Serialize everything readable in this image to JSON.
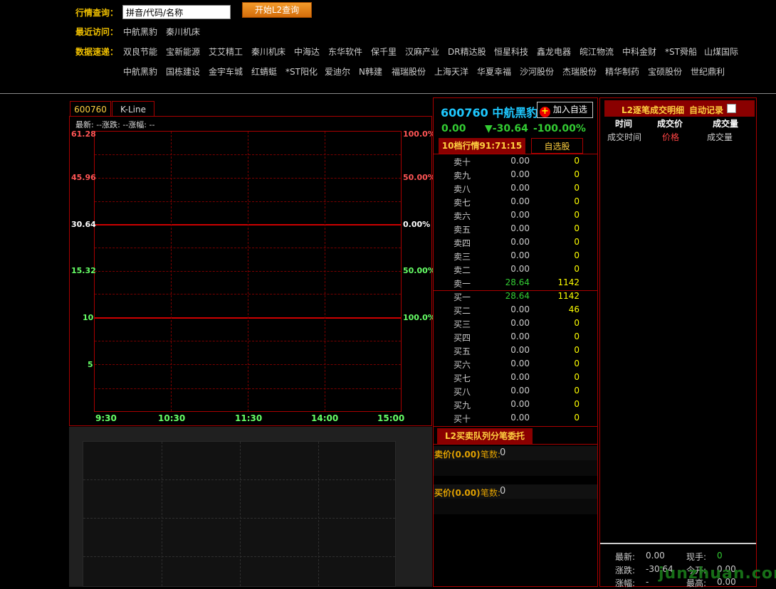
{
  "header": {
    "query_label": "行情查询：",
    "search_placeholder": "拼音/代码/名称",
    "search_button": "开始L2查询",
    "recent_label": "最近访问：",
    "recent": [
      "中航黑豹",
      "秦川机床"
    ],
    "quick_label": "数据速递：",
    "quick_row1": [
      "双良节能",
      "宝新能源",
      "艾艾精工",
      "秦川机床",
      "中海达",
      "东华软件",
      "保千里",
      "汉麻产业",
      "DR精达股",
      "恒星科技",
      "鑫龙电器",
      "皖江物流",
      "中科金财",
      "*ST舜船",
      "山煤国际"
    ],
    "quick_row2": [
      "中航黑豹",
      "国栋建设",
      "金宇车城",
      "红蜻蜓",
      "*ST阳化",
      "爱迪尔",
      "N韩建",
      "福瑞股份",
      "上海天洋",
      "华夏幸福",
      "沙河股份",
      "杰瑞股份",
      "精华制药",
      "宝硕股份",
      "世纪鼎利"
    ]
  },
  "chart": {
    "tabs": [
      "600760",
      "K-Line"
    ],
    "info": "最新: --涨跌: --涨幅: --",
    "y_left": [
      "61.28",
      "45.96",
      "30.64",
      "15.32",
      "10",
      "5"
    ],
    "y_right": [
      "100.0%",
      "50.00%",
      "0.00%",
      "50.00%",
      "100.0%"
    ],
    "x": [
      "9:30",
      "10:30",
      "11:30",
      "14:00",
      "15:00"
    ]
  },
  "stock": {
    "code_name": "600760 中航黑豹",
    "add_button": "加入自选",
    "price": "0.00",
    "change": "▼-30.64",
    "pct": "-100.00%",
    "tab_level10": "10档行情91:71:15",
    "tab_watch": "自选股",
    "sell": [
      {
        "label": "卖十",
        "price": "0.00",
        "vol": "0"
      },
      {
        "label": "卖九",
        "price": "0.00",
        "vol": "0"
      },
      {
        "label": "卖八",
        "price": "0.00",
        "vol": "0"
      },
      {
        "label": "卖七",
        "price": "0.00",
        "vol": "0"
      },
      {
        "label": "卖六",
        "price": "0.00",
        "vol": "0"
      },
      {
        "label": "卖五",
        "price": "0.00",
        "vol": "0"
      },
      {
        "label": "卖四",
        "price": "0.00",
        "vol": "0"
      },
      {
        "label": "卖三",
        "price": "0.00",
        "vol": "0"
      },
      {
        "label": "卖二",
        "price": "0.00",
        "vol": "0"
      },
      {
        "label": "卖一",
        "price": "28.64",
        "vol": "1142"
      }
    ],
    "buy": [
      {
        "label": "买一",
        "price": "28.64",
        "vol": "1142"
      },
      {
        "label": "买二",
        "price": "0.00",
        "vol": "46"
      },
      {
        "label": "买三",
        "price": "0.00",
        "vol": "0"
      },
      {
        "label": "买四",
        "price": "0.00",
        "vol": "0"
      },
      {
        "label": "买五",
        "price": "0.00",
        "vol": "0"
      },
      {
        "label": "买六",
        "price": "0.00",
        "vol": "0"
      },
      {
        "label": "买七",
        "price": "0.00",
        "vol": "0"
      },
      {
        "label": "买八",
        "price": "0.00",
        "vol": "0"
      },
      {
        "label": "买九",
        "price": "0.00",
        "vol": "0"
      },
      {
        "label": "买十",
        "price": "0.00",
        "vol": "0"
      }
    ],
    "queue_tab": "L2买卖队列分笔委托",
    "sell_queue_label": "卖价(0.00)",
    "buy_queue_label": "买价(0.00)",
    "count_label": "笔数:",
    "count_value": "0"
  },
  "detail": {
    "title": "L2逐笔成交明细",
    "auto_label": "自动记录",
    "headers1": [
      "时间",
      "成交价",
      "成交量"
    ],
    "headers2": [
      "成交时间",
      "价格",
      "成交量"
    ],
    "stats": {
      "latest_label": "最新:",
      "latest": "0.00",
      "hand_label": "现手:",
      "hand": "0",
      "change_label": "涨跌:",
      "change": "-30.64",
      "open_label": "今开:",
      "open": "0.00",
      "pct_label": "涨幅:",
      "pct": "-",
      "high_label": "最高:",
      "high": "0.00"
    }
  },
  "watermark": "junzhuan.com"
}
